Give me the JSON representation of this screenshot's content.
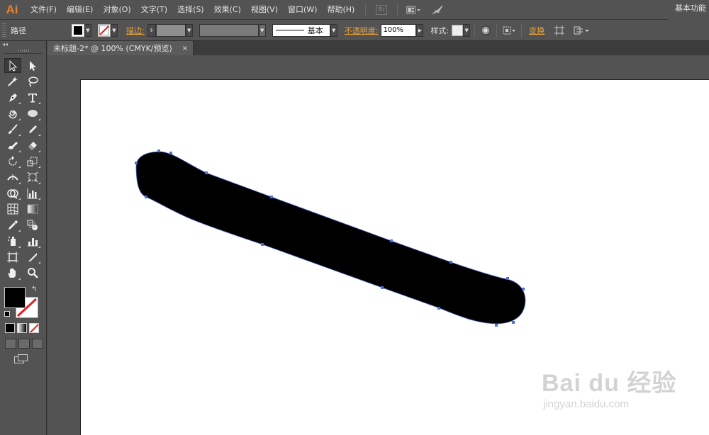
{
  "app": {
    "logo": "Ai",
    "workspace": "基本功能"
  },
  "menu": [
    "文件(F)",
    "编辑(E)",
    "对象(O)",
    "文字(T)",
    "选择(S)",
    "效果(C)",
    "视图(V)",
    "窗口(W)",
    "帮助(H)"
  ],
  "menubar_icons": {
    "bridge": "Br"
  },
  "control": {
    "selection_label": "路径",
    "stroke_label": "描边:",
    "stroke_profile": "基本",
    "opacity_label": "不透明度:",
    "opacity_value": "100%",
    "style_label": "样式:",
    "transform_label": "变换"
  },
  "document": {
    "tab_title": "未标题-2* @ 100% (CMYK/预览)",
    "close_glyph": "×"
  },
  "watermark": {
    "brand": "Bai du 经验",
    "url": "jingyan.baidu.com"
  },
  "colors": {
    "accent": "#e8822a",
    "panel": "#535353",
    "anchor": "#4f6fd6",
    "fill": "#000000"
  }
}
